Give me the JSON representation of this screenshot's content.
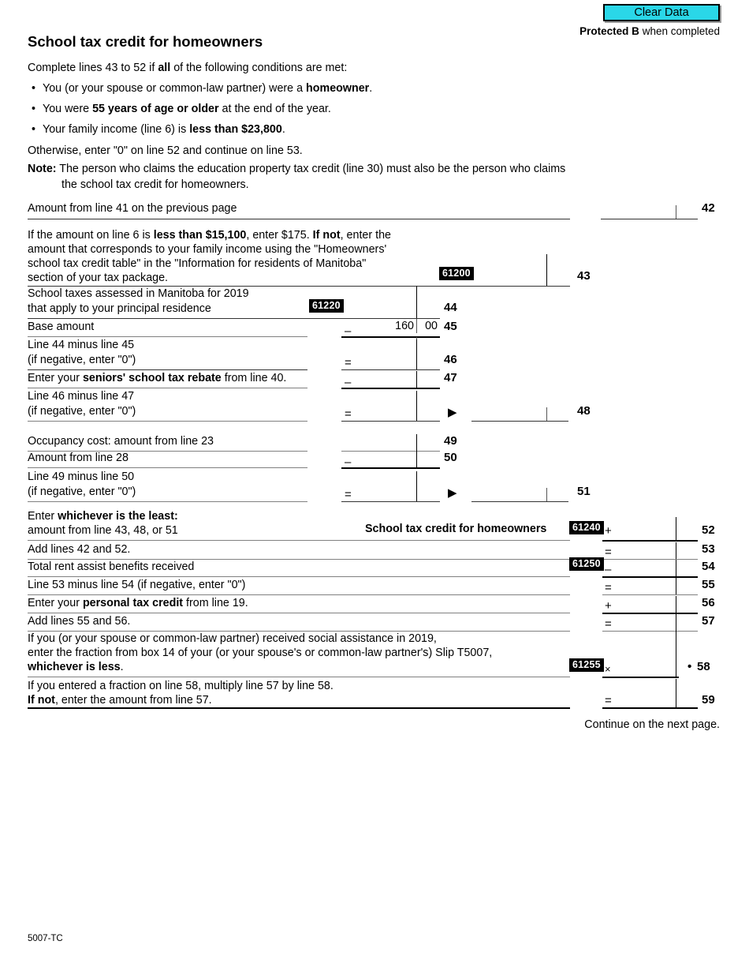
{
  "toolbar": {
    "clear_data_label": "Clear Data",
    "clear_data_color": "#2ad7e8"
  },
  "header": {
    "protected_bold": "Protected B",
    "protected_rest": " when completed",
    "title": "School tax credit for homeowners"
  },
  "intro": {
    "lead_a": "Complete lines 43 to 52 if ",
    "lead_bold": "all",
    "lead_b": " of the following conditions are met:",
    "bullets": [
      {
        "a": "You (or your spouse or common-law partner) were a ",
        "b": "homeowner",
        "c": "."
      },
      {
        "a": "You were ",
        "b": "55 years of age or older",
        "c": " at the end of the year."
      },
      {
        "a": "Your family income (line 6) is ",
        "b": "less than $23,800",
        "c": "."
      }
    ],
    "otherwise": "Otherwise, enter \"0\" on line 52 and continue on line 53.",
    "note_label": "Note:",
    "note_line1": " The person who claims the education property tax credit (line 30) must also be the person who claims",
    "note_line2": "the school tax credit for homeowners."
  },
  "lines": {
    "l42": {
      "label": "Amount from line 41 on the previous page",
      "number": "42"
    },
    "l43": {
      "t1_a": "If the amount on line 6 is ",
      "t1_b": "less than $15,100",
      "t1_c": ", enter $175. ",
      "t1_d": "If not",
      "t1_e": ", enter the",
      "t2": "amount that corresponds to your family income using the \"Homeowners'",
      "t3": "school tax credit table\" in the \"Information for residents of Manitoba\"",
      "t4": "section of your tax package.",
      "code": "61200",
      "number": "43"
    },
    "l44": {
      "t1": "School taxes assessed in Manitoba for 2019",
      "t2": "that apply to your principal residence",
      "code": "61220",
      "number": "44"
    },
    "l45": {
      "label": "Base amount",
      "op": "–",
      "dollars": "160",
      "cents": "00",
      "number": "45"
    },
    "l46": {
      "t1": "Line 44 minus line 45",
      "t2": "(if negative, enter \"0\")",
      "op": "=",
      "number": "46"
    },
    "l47": {
      "a": "Enter your ",
      "b": "seniors' school tax rebate",
      "c": " from line 40.",
      "op": "–",
      "number": "47"
    },
    "l48": {
      "t1": "Line 46 minus line 47",
      "t2": "(if negative, enter \"0\")",
      "op": "=",
      "arrow": "▶",
      "number": "48"
    },
    "l49": {
      "label": "Occupancy cost: amount from line 23",
      "number": "49"
    },
    "l50": {
      "label": "Amount from line 28",
      "op": "–",
      "number": "50"
    },
    "l51": {
      "t1": "Line 49 minus line 50",
      "t2": "(if negative, enter \"0\")",
      "op": "=",
      "arrow": "▶",
      "number": "51"
    },
    "l52": {
      "t1_a": "Enter ",
      "t1_b": "whichever is the least:",
      "t2": "amount from line 43, 48, or 51",
      "credit_label": "School tax credit for homeowners",
      "code": "61240",
      "op": "+",
      "number": "52"
    },
    "l53": {
      "label": "Add lines 42 and 52.",
      "op": "=",
      "number": "53"
    },
    "l54": {
      "label": "Total rent assist benefits received",
      "code": "61250",
      "op": "–",
      "number": "54"
    },
    "l55": {
      "label": "Line 53 minus line 54 (if negative, enter \"0\")",
      "op": "=",
      "number": "55"
    },
    "l56": {
      "a": "Enter your ",
      "b": "personal tax credit",
      "c": " from line 19.",
      "op": "+",
      "number": "56"
    },
    "l57": {
      "label": "Add lines 55 and 56.",
      "op": "=",
      "number": "57"
    },
    "l58": {
      "t1": "If you (or your spouse or common-law partner) received social assistance in 2019,",
      "t2": "enter the fraction from box 14 of your (or your spouse's or common-law partner's) Slip T5007,",
      "t3_b": "whichever is less",
      "t3_c": ".",
      "code": "61255",
      "op": "×",
      "dot": "•",
      "number": "58"
    },
    "l59": {
      "t1": "If you entered a fraction on line 58, multiply line 57 by line 58.",
      "t2_b": "If not",
      "t2_c": ", enter the amount from line 57.",
      "op": "=",
      "number": "59"
    }
  },
  "footer": {
    "continue_note": "Continue on the next page.",
    "form_code": "5007-TC"
  }
}
